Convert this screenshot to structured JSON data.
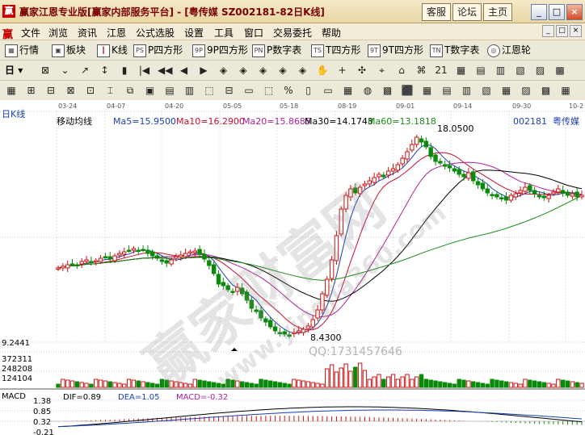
{
  "titlebar": {
    "logo": "赢",
    "title": "赢家江恩专业版[赢家内部服务平台] - [粤传媒   SZ002181-82日K线]",
    "buttons": [
      "客服",
      "论坛",
      "主页"
    ]
  },
  "window_controls": [
    "_",
    "□",
    "×"
  ],
  "menu": {
    "logo": "赢",
    "items": [
      "文件",
      "浏览",
      "资讯",
      "江恩",
      "公式选股",
      "设置",
      "工具",
      "窗口",
      "交易委托",
      "帮助"
    ],
    "mdi": [
      "_",
      "□",
      "×"
    ]
  },
  "toolbar1": [
    {
      "icon": "grid-icon",
      "label": "行情"
    },
    {
      "icon": "blocks-icon",
      "label": "板块"
    },
    {
      "icon": "candle-icon",
      "label": "K线"
    },
    {
      "icon": "ps-icon",
      "icon_text": "PS",
      "label": "P四方形"
    },
    {
      "icon": "9p-icon",
      "icon_text": "9P",
      "label": "9P四方形"
    },
    {
      "icon": "pn-icon",
      "icon_text": "PN",
      "label": "P数字表"
    },
    {
      "icon": "ts-icon",
      "icon_text": "TS",
      "label": "T四方形"
    },
    {
      "icon": "9t-icon",
      "icon_text": "9T",
      "label": "9T四方形"
    },
    {
      "icon": "tn-icon",
      "icon_text": "TN",
      "label": "T数字表"
    },
    {
      "icon": "wheel-icon",
      "label": "江恩轮"
    }
  ],
  "toolbar2": {
    "period": "日",
    "glyphs": [
      "⊠",
      "⌄",
      "↗",
      "↕",
      "▮",
      "|◀",
      "◀◀",
      "◀",
      "▶",
      "◈",
      "◈",
      "◈",
      "◈",
      "◈",
      "✋",
      "+",
      "✣",
      "⌖",
      "⌂",
      "⌘",
      "21",
      "▦",
      "▤",
      "▥",
      "▧",
      "▨",
      "▩"
    ]
  },
  "toolbar3": {
    "glyphs": [
      "▦",
      "⊞",
      "⊟",
      "⊠",
      "⊡",
      "⌶",
      "⧉",
      "▣",
      "▤",
      "▥",
      "⬚",
      "⊟",
      "▭",
      "⬚",
      "%",
      "▯",
      "▭",
      "▦",
      "◍",
      "▩",
      "⬛",
      "▦",
      "▤",
      "▥",
      "▧",
      "▦",
      "▨",
      "▩",
      "▦"
    ]
  },
  "chart": {
    "period_label": "日K线",
    "indicator_label": "移动均线",
    "stock_code": "002181",
    "stock_name": "粤传媒",
    "ma_legend": [
      {
        "text": "Ma5=15.9500",
        "color": "#1a3fb0"
      },
      {
        "text": "Ma10=16.2900",
        "color": "#c8102e"
      },
      {
        "text": "Ma20=15.8685",
        "color": "#b0209a"
      },
      {
        "text": "Ma30=14.1743",
        "color": "#000000"
      },
      {
        "text": "Ma60=13.1818",
        "color": "#1a8a1a"
      }
    ],
    "dates": [
      "03-24",
      "04-07",
      "04-20",
      "05-05",
      "05-18",
      "08-19",
      "09-01",
      "09-14",
      "09-30",
      "10-2"
    ],
    "high_label": "18.0500",
    "low_label": "8.4300",
    "price_axis_low": "9.2441",
    "volume_axis": [
      "372311",
      "248208",
      "124104"
    ],
    "macd_title": "MACD",
    "macd_legend": [
      {
        "text": "DIF=0.89",
        "color": "#000000"
      },
      {
        "text": "DEA=1.05",
        "color": "#1a3fb0"
      },
      {
        "text": "MACD=-0.32",
        "color": "#b0209a"
      }
    ],
    "macd_axis": [
      "1.38",
      "0.85",
      "0.32",
      "-0.21"
    ],
    "watermark_cn": "赢家财富网",
    "watermark_url": "www.yingjia360.com",
    "watermark_qq": "QQ:1731457646",
    "colors": {
      "up": "#d01010",
      "down": "#0a8a0a",
      "grid": "#9a9a9a"
    }
  }
}
